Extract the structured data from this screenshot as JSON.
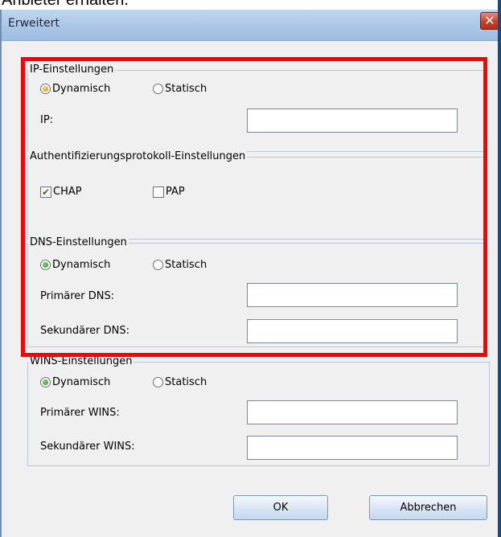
{
  "caption": "Anbieter erhalten.",
  "window": {
    "title": "Erweitert",
    "close_symbol": "✕"
  },
  "ip_settings": {
    "legend": "IP-Einstellungen",
    "dynamic_label": "Dynamisch",
    "static_label": "Statisch",
    "selected": "Dynamisch",
    "ip_label": "IP:",
    "ip_value": ""
  },
  "auth_settings": {
    "legend": "Authentifizierungsprotokoll-Einstellungen",
    "chap_label": "CHAP",
    "chap_checked": true,
    "pap_label": "PAP",
    "pap_checked": false
  },
  "dns_settings": {
    "legend": "DNS-Einstellungen",
    "dynamic_label": "Dynamisch",
    "static_label": "Statisch",
    "selected": "Dynamisch",
    "primary_label": "Primärer DNS:",
    "primary_value": "",
    "secondary_label": "Sekundärer DNS:",
    "secondary_value": ""
  },
  "wins_settings": {
    "legend": "WINS-Einstellungen",
    "dynamic_label": "Dynamisch",
    "static_label": "Statisch",
    "selected": "Dynamisch",
    "primary_label": "Primärer WINS:",
    "primary_value": "",
    "secondary_label": "Sekundärer WINS:",
    "secondary_value": ""
  },
  "buttons": {
    "ok_label": "OK",
    "cancel_label": "Abbrechen"
  },
  "colors": {
    "highlight": "#ff0000",
    "check": "#2b7c1e",
    "titlebar": "#a9c5e6"
  },
  "icons": {
    "close": "close-icon",
    "radio_selected": "radio-selected-icon",
    "checkmark": "checkmark-icon"
  }
}
